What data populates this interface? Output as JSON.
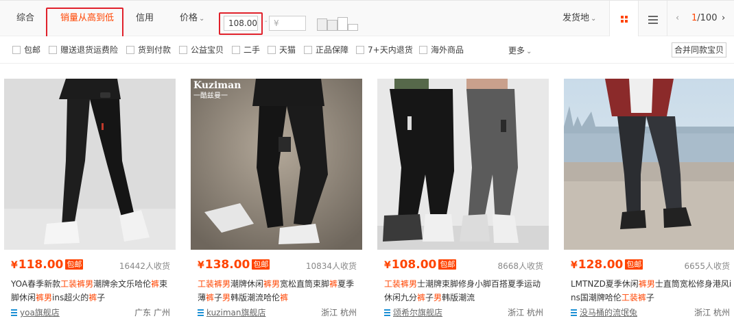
{
  "sortbar": {
    "tabs": [
      {
        "label": "综合",
        "active": false
      },
      {
        "label": "销量从高到低",
        "active": true
      },
      {
        "label": "信用",
        "active": false
      },
      {
        "label": "价格",
        "active": false
      }
    ],
    "price_min_value": "108.00",
    "price_max_placeholder": "¥",
    "price_dash": "-",
    "ship_from": "发货地",
    "chevron": "⌄",
    "pager_current": "1",
    "pager_total": "/100",
    "prev_arrow": "‹",
    "next_arrow": "›"
  },
  "filters": [
    {
      "label": "包邮"
    },
    {
      "label": "赠送退货运费险"
    },
    {
      "label": "货到付款"
    },
    {
      "label": "公益宝贝"
    },
    {
      "label": "二手"
    },
    {
      "label": "天猫"
    },
    {
      "label": "正品保障"
    },
    {
      "label": "7+天内退货"
    },
    {
      "label": "海外商品"
    }
  ],
  "more_label": "更多",
  "merge_label": "合并同款宝贝",
  "products": [
    {
      "currency": "¥",
      "price": "118.00",
      "badge": "包邮",
      "sales": "16442人收货",
      "title_parts": [
        [
          "YOA春季新款",
          false
        ],
        [
          "工装裤男",
          true
        ],
        [
          "潮牌余文乐哈伦",
          false
        ],
        [
          "裤",
          true
        ],
        [
          "束脚休闲",
          false
        ],
        [
          "裤男",
          true
        ],
        [
          "ins超火的",
          false
        ],
        [
          "裤",
          true
        ],
        [
          "子",
          false
        ]
      ],
      "shop": "yoa旗舰店",
      "location": "广东 广州"
    },
    {
      "currency": "¥",
      "price": "138.00",
      "badge": "包邮",
      "sales": "10834人收货",
      "title_parts": [
        [
          "工装裤男",
          true
        ],
        [
          "潮牌休闲",
          false
        ],
        [
          "裤男",
          true
        ],
        [
          "宽松直筒束脚",
          false
        ],
        [
          "裤",
          true
        ],
        [
          "夏季薄",
          false
        ],
        [
          "裤",
          true
        ],
        [
          "子",
          false
        ],
        [
          "男",
          true
        ],
        [
          "韩版潮流哈伦",
          false
        ],
        [
          "裤",
          true
        ]
      ],
      "shop": "kuziman旗舰店",
      "location": "浙江 杭州"
    },
    {
      "currency": "¥",
      "price": "108.00",
      "badge": "包邮",
      "sales": "8668人收货",
      "title_parts": [
        [
          "工装裤男",
          true
        ],
        [
          "士潮牌束脚修身小脚百搭夏季运动休闲九分",
          false
        ],
        [
          "裤",
          true
        ],
        [
          "子",
          false
        ],
        [
          "男",
          true
        ],
        [
          "韩版潮流",
          false
        ]
      ],
      "shop": "颂希尔旗舰店",
      "location": "浙江 杭州"
    },
    {
      "currency": "¥",
      "price": "128.00",
      "badge": "包邮",
      "sales": "6655人收货",
      "title_parts": [
        [
          "LMTNZD夏季休闲",
          false
        ],
        [
          "裤男",
          true
        ],
        [
          "士直筒宽松修身港风ins国潮牌哈伦",
          false
        ],
        [
          "工装裤",
          true
        ],
        [
          "子",
          false
        ]
      ],
      "shop": "没马桶的流氓兔",
      "location": "浙江 杭州"
    }
  ],
  "photo2_brand": "Kuziman",
  "photo2_brand_sub": "一酷兹曼一",
  "colors": {
    "accent": "#ff4400",
    "highlight": "#e0202a",
    "link_blue": "#1a8fd4"
  }
}
